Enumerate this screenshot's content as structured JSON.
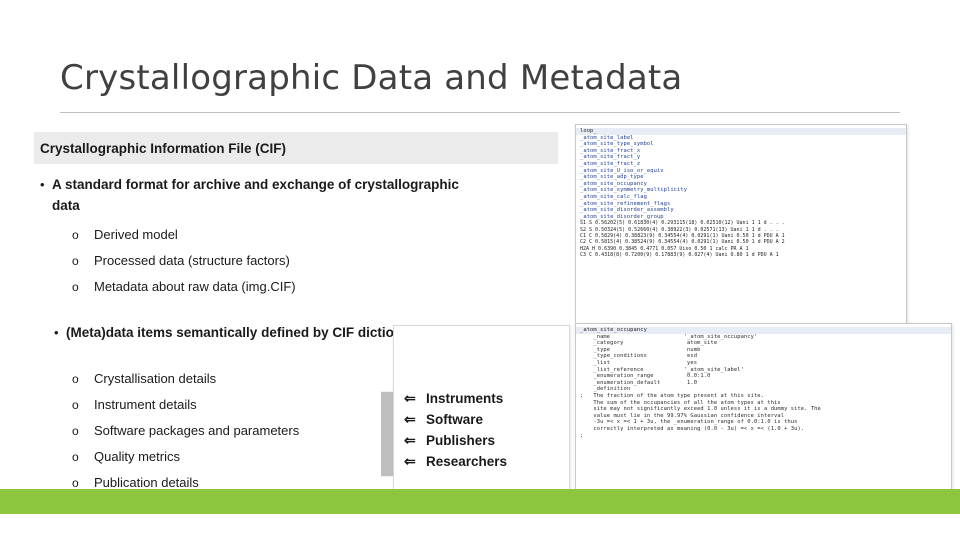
{
  "slide": {
    "title": "Crystallographic Data and Metadata",
    "section_header": "Crystallographic Information File (CIF)",
    "bullets": [
      {
        "marker": "•",
        "text": "A standard format for archive and exchange of crystallographic data",
        "sub": [
          "Derived model",
          "Processed data (structure factors)",
          "Metadata about raw data (img.CIF)"
        ]
      },
      {
        "marker": "•",
        "text": "(Meta)data items semantically defined by CIF dictionaries",
        "sub": [
          "Crystallisation details",
          "Instrument details",
          "Software packages and parameters",
          "Quality metrics",
          "Publication details"
        ]
      }
    ],
    "callout": {
      "arrow_glyph": "⇐",
      "items": [
        "Instruments",
        "Software",
        "Publishers",
        "Researchers"
      ]
    },
    "sub_marker": "o",
    "colors": {
      "accent_green": "#8cc63e",
      "header_band": "#ebebeb",
      "title_text": "#404040",
      "arrow_grey": "#bfbfbf"
    }
  },
  "code_top": {
    "lines": [
      "loop_",
      "_atom_site_label",
      "_atom_site_type_symbol",
      "_atom_site_fract_x",
      "_atom_site_fract_y",
      "_atom_site_fract_z",
      "_atom_site_U_iso_or_equiv",
      "_atom_site_adp_type",
      "_atom_site_occupancy",
      "_atom_site_symmetry_multiplicity",
      "_atom_site_calc_flag",
      "_atom_site_refinement_flags",
      "_atom_site_disorder_assembly",
      "_atom_site_disorder_group",
      "S1 S 0.56202(5) 0.61830(4) 0.293115(18) 0.02510(12) Uani 1 1 d . . .",
      "S2 S 0.50324(5) 0.52660(4) 0.38922(3) 0.02571(13) Uani 1 1 d . . .",
      "C1 C 0.5829(4) 0.38823(9) 0.34554(4) 0.0291(1) Uani 0.50 1 d PDU A 1",
      "C2 C 0.5815(4) 0.38524(9) 0.34554(4) 0.0291(1) Uani 0.50 1 d PDU A 2",
      "H2A H 0.6390 0.3845 0.4771 0.057 Uiso 0.50 1 calc PR A 1",
      "C3 C 0.4318(8) 0.7200(9) 0.17883(9) 0.027(4) Uani 0.80 1 d PDU A 1"
    ]
  },
  "code_bottom": {
    "title": "_atom_site_occupancy",
    "lines": [
      "    _name                      '_atom_site_occupancy'",
      "    _category                   atom_site",
      "    _type                       numb",
      "    _type_conditions            esd",
      "    _list                       yes",
      "    _list_reference            '_atom_site_label'",
      "    _enumeration_range          0.0:1.0",
      "    _enumeration_default        1.0",
      "    _definition",
      ";   The fraction of the atom type present at this site.",
      "    The sum of the occupancies of all the atom types at this",
      "    site may not significantly exceed 1.0 unless it is a dummy site. The",
      "    value must lie in the 99.97% Gaussian confidence interval",
      "    -3u =< x =< 1 + 3u, the _enumeration_range of 0.0:1.0 is thus",
      "    correctly interpreted as meaning (0.0 - 3u) =< x =< (1.0 + 3u).",
      ";"
    ]
  }
}
